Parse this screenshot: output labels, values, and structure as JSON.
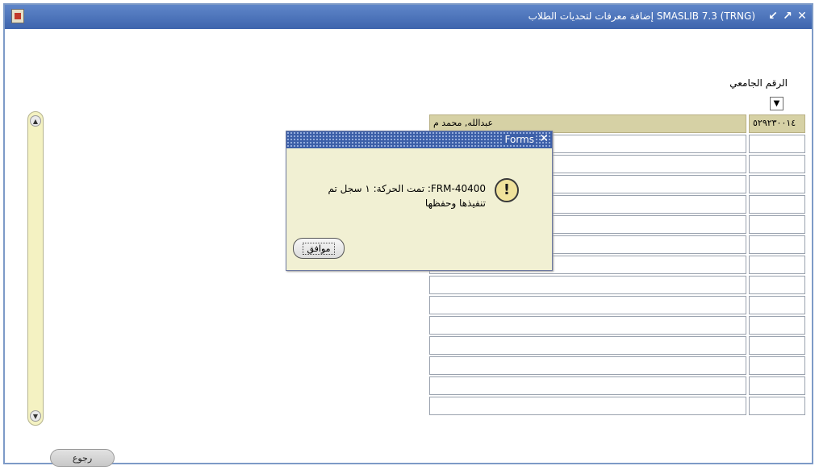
{
  "window": {
    "title": "(SMASLIB 7.3 (TRNG إضافة معرفات لتحديات الطلاب",
    "controls": [
      "minimize-icon",
      "maximize-icon",
      "close-icon"
    ]
  },
  "form": {
    "university_id_label": "الرقم الجامعي",
    "rows": [
      {
        "name": "عبدالله, محمد م",
        "id": "٥٢٩٢٣٠٠١٤"
      },
      {
        "name": "",
        "id": ""
      },
      {
        "name": "",
        "id": ""
      },
      {
        "name": "",
        "id": ""
      },
      {
        "name": "",
        "id": ""
      },
      {
        "name": "",
        "id": ""
      },
      {
        "name": "",
        "id": ""
      },
      {
        "name": "",
        "id": ""
      },
      {
        "name": "",
        "id": ""
      },
      {
        "name": "",
        "id": ""
      },
      {
        "name": "",
        "id": ""
      },
      {
        "name": "",
        "id": ""
      },
      {
        "name": "",
        "id": ""
      },
      {
        "name": "",
        "id": ""
      },
      {
        "name": "",
        "id": ""
      }
    ],
    "back_label": "رجوع"
  },
  "dialog": {
    "title": "Forms",
    "message": "FRM-40400: تمت الحركة: ١ سجل تم تنفيذها وحفظها",
    "ok_label": "موافق",
    "icon": "warning-icon"
  },
  "colors": {
    "titlebar": "#4a72b8",
    "selected_row": "#d6d1a5",
    "dialog_bg": "#f1f0d3"
  }
}
